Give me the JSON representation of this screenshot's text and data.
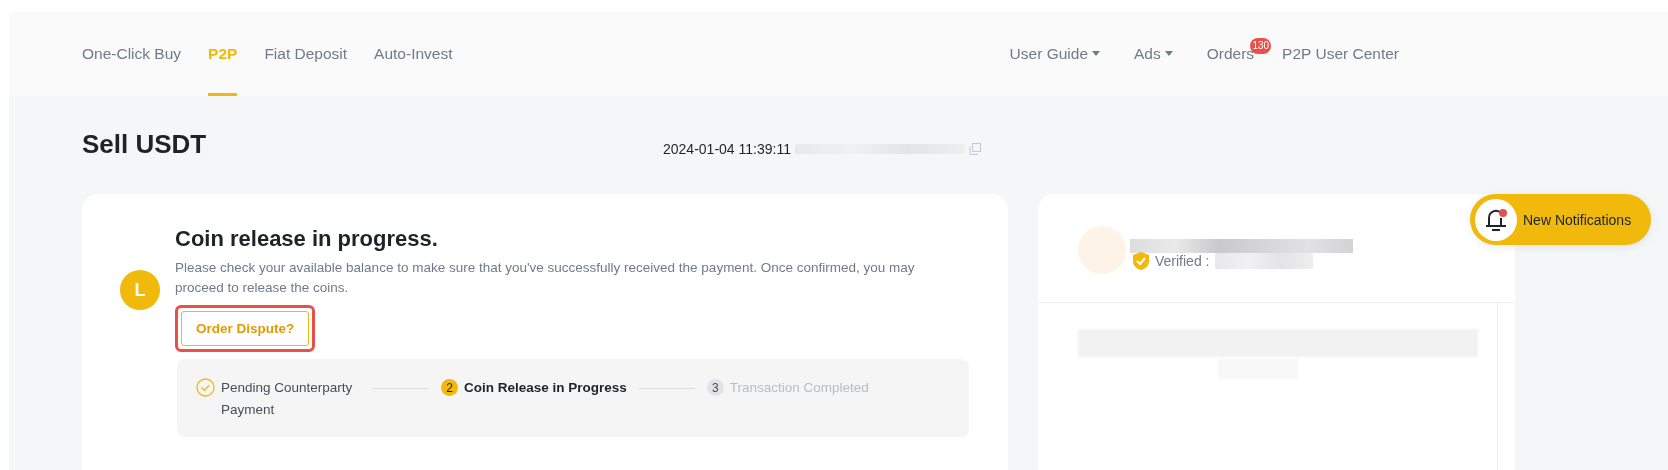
{
  "nav": {
    "tabs": [
      {
        "label": "One-Click Buy",
        "selected": false
      },
      {
        "label": "P2P",
        "selected": true
      },
      {
        "label": "Fiat Deposit",
        "selected": false
      },
      {
        "label": "Auto-Invest",
        "selected": false
      }
    ],
    "links": [
      {
        "label": "User Guide",
        "kind": "dropdown"
      },
      {
        "label": "Ads",
        "kind": "dropdown"
      },
      {
        "label": "Orders",
        "kind": "badge",
        "badge": "130"
      },
      {
        "label": "P2P User Center",
        "kind": "plain"
      }
    ]
  },
  "header": {
    "title": "Sell USDT",
    "timestamp": "2024-01-04 11:39:11"
  },
  "status": {
    "avatar_letter": "L",
    "heading": "Coin release in progress.",
    "message": "Please check your available balance to make sure that you've successfully received the payment. Once confirmed, you may proceed to release the coins.",
    "dispute_button": {
      "label": "Order Dispute?",
      "highlighted": true
    },
    "steps": [
      {
        "label": "Pending Counterparty Payment",
        "completed": true,
        "current": false
      },
      {
        "number": "2",
        "label": "Coin Release in Progress",
        "completed": false,
        "current": true
      },
      {
        "number": "3",
        "label": "Transaction Completed",
        "completed": false,
        "current": false
      }
    ]
  },
  "counterparty": {
    "verified_label": "Verified :"
  },
  "notification": {
    "label": "New Notifications",
    "unread": true
  }
}
